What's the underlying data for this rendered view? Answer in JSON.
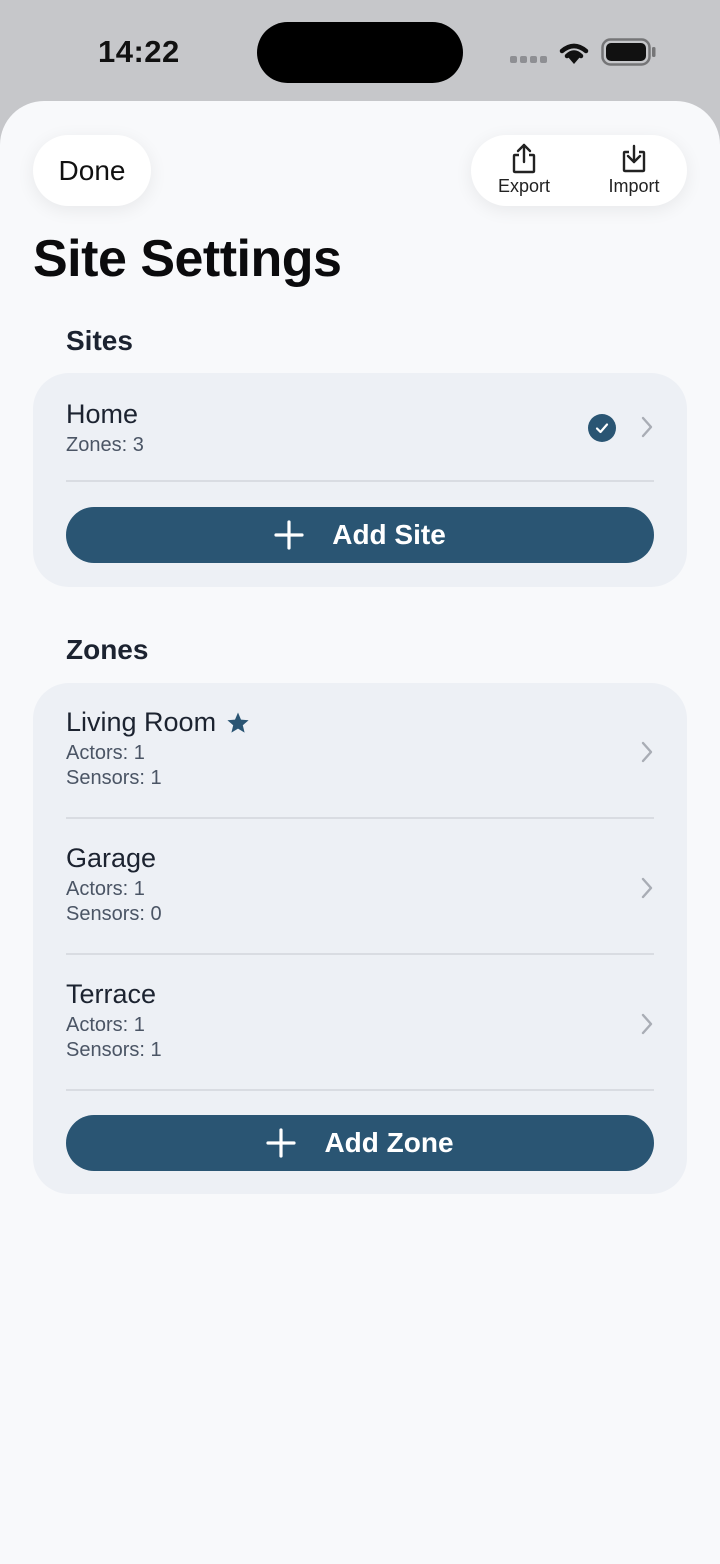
{
  "status_bar": {
    "time": "14:22"
  },
  "header": {
    "done_label": "Done",
    "export_label": "Export",
    "import_label": "Import"
  },
  "page_title": "Site Settings",
  "sites": {
    "section_title": "Sites",
    "items": [
      {
        "name": "Home",
        "detail": "Zones: 3",
        "selected": true
      }
    ],
    "add_label": "Add Site"
  },
  "zones": {
    "section_title": "Zones",
    "items": [
      {
        "name": "Living Room",
        "actors": "Actors: 1",
        "sensors": "Sensors: 1",
        "favorite": true
      },
      {
        "name": "Garage",
        "actors": "Actors: 1",
        "sensors": "Sensors: 0",
        "favorite": false
      },
      {
        "name": "Terrace",
        "actors": "Actors: 1",
        "sensors": "Sensors: 1",
        "favorite": false
      }
    ],
    "add_label": "Add Zone"
  },
  "colors": {
    "accent": "#2a5573",
    "card_bg": "#edf0f5",
    "sheet_bg": "#f8f9fb"
  }
}
